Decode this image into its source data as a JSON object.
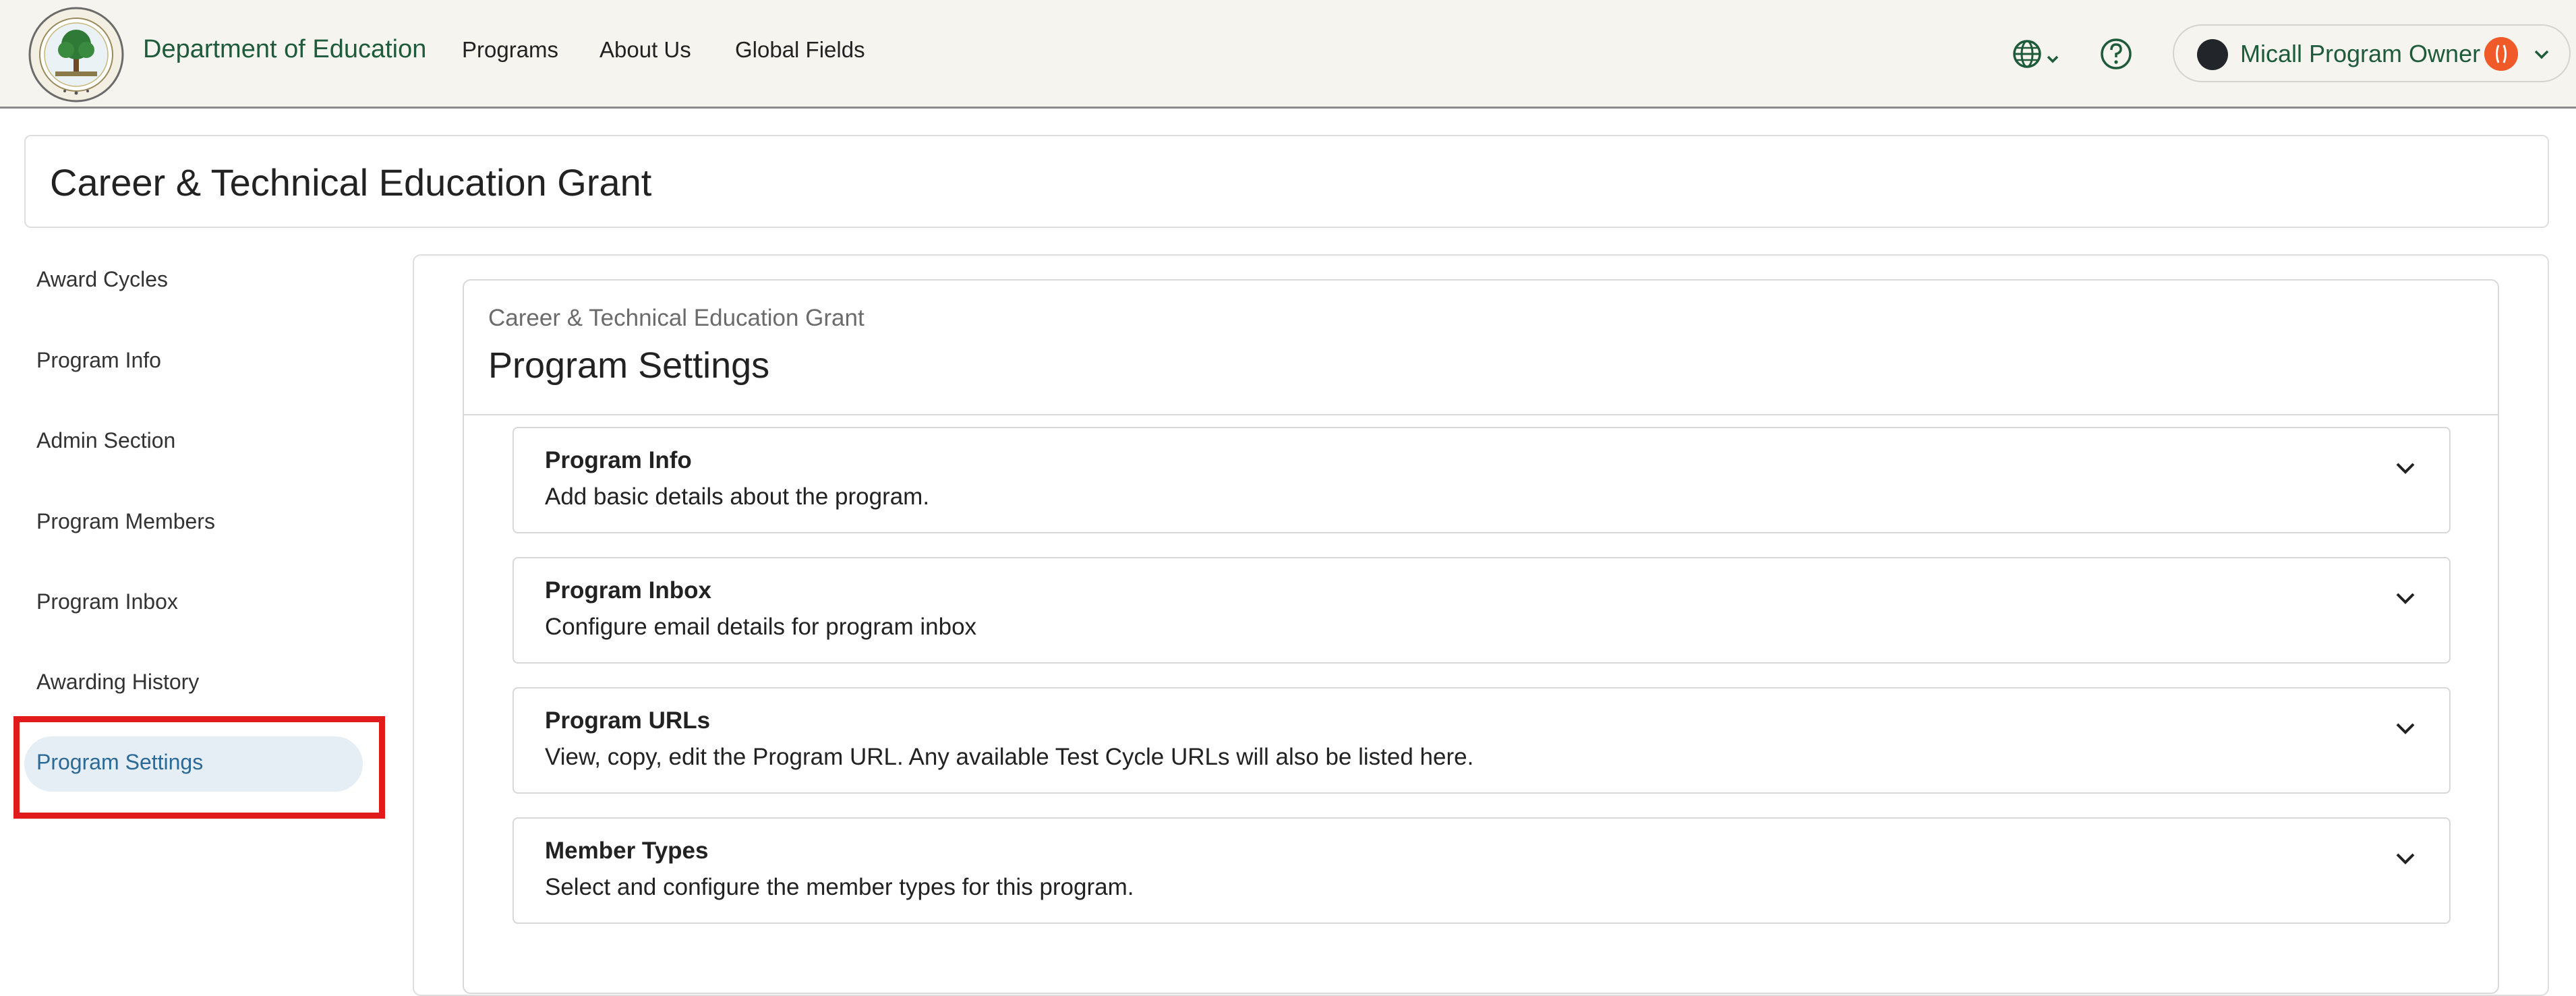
{
  "header": {
    "brand_title": "Department of Education",
    "nav": [
      {
        "label": "Programs"
      },
      {
        "label": "About Us"
      },
      {
        "label": "Global Fields"
      }
    ],
    "icons": {
      "language": "globe-icon",
      "help": "help-circle-icon",
      "expand": "chevron-down-icon"
    },
    "user": {
      "name": "Micall Program Owner",
      "badge_icon": "accessibility-icon",
      "badge_color": "#f05a28"
    }
  },
  "program": {
    "title": "Career & Technical Education Grant"
  },
  "sidebar": {
    "items": [
      {
        "label": "Award Cycles"
      },
      {
        "label": "Program Info"
      },
      {
        "label": "Admin Section"
      },
      {
        "label": "Program Members"
      },
      {
        "label": "Program Inbox"
      },
      {
        "label": "Awarding History"
      },
      {
        "label": "Program Settings",
        "active": true
      }
    ]
  },
  "settings": {
    "breadcrumb": "Career & Technical Education Grant",
    "title": "Program Settings",
    "sections": [
      {
        "title": "Program Info",
        "description": "Add basic details about the program."
      },
      {
        "title": "Program Inbox",
        "description": "Configure email details for program inbox"
      },
      {
        "title": "Program URLs",
        "description": "View, copy, edit the Program URL. Any available Test Cycle URLs will also be listed here."
      },
      {
        "title": "Member Types",
        "description": "Select and configure the member types for this program."
      }
    ]
  },
  "colors": {
    "brand_green": "#1e5b3b",
    "topbar_bg": "#f6f4ee",
    "active_bg": "#e6eef5",
    "active_text": "#2b6a97",
    "highlight_red": "#e11b1b"
  }
}
